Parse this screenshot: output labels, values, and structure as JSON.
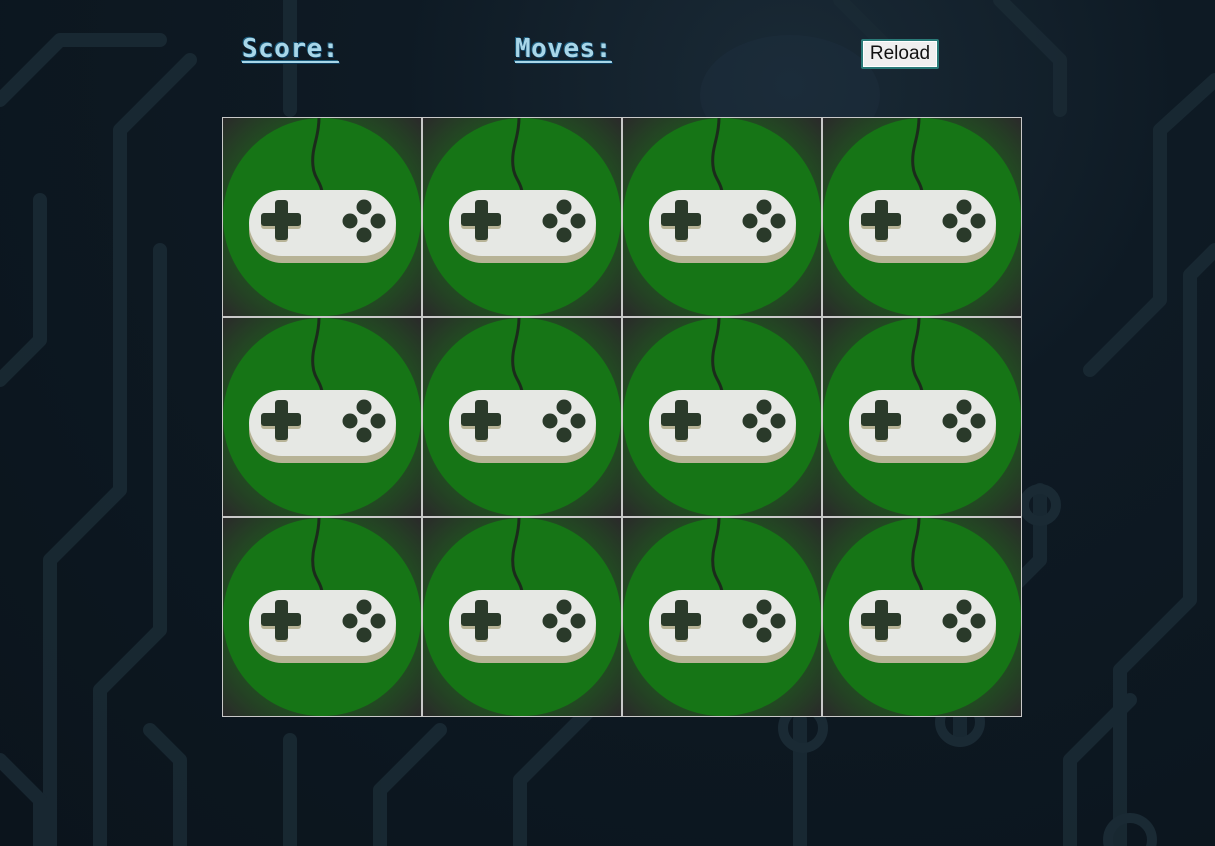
{
  "hud": {
    "score_label": "Score:",
    "moves_label": "Moves:",
    "reload_label": "Reload"
  },
  "board": {
    "rows": 3,
    "columns": 4,
    "card_state": "face-down",
    "card_back_icon": "gamepad-icon",
    "cards": [
      {
        "id": 1
      },
      {
        "id": 2
      },
      {
        "id": 3
      },
      {
        "id": 4
      },
      {
        "id": 5
      },
      {
        "id": 6
      },
      {
        "id": 7
      },
      {
        "id": 8
      },
      {
        "id": 9
      },
      {
        "id": 10
      },
      {
        "id": 11
      },
      {
        "id": 12
      }
    ]
  },
  "colors": {
    "background": "#0e1a24",
    "hud_text": "#a8d6e8",
    "card_circle": "#167516",
    "controller_body": "#e6e8e4",
    "controller_shadow": "#b7b396",
    "controller_buttons": "#2a3a2a",
    "card_border": "#c8c8c8"
  }
}
